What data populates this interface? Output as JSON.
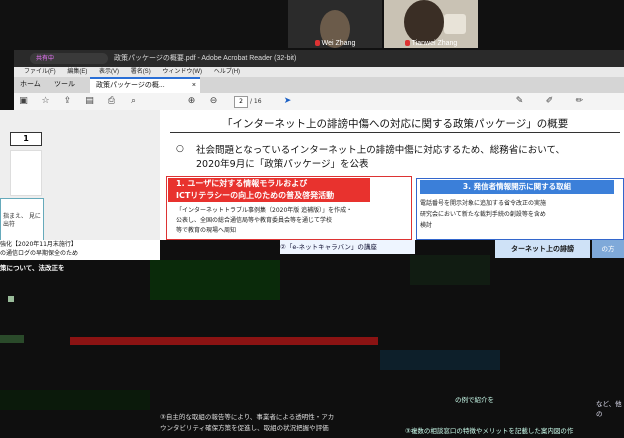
{
  "video": {
    "participants": [
      {
        "name": "Wei Zhang"
      },
      {
        "name": "Tianwei Zhang"
      }
    ]
  },
  "window": {
    "title": "政策パッケージの概要.pdf - Adobe Acrobat Reader (32-bit)",
    "share_indicator": "共有中"
  },
  "menu": {
    "items": [
      "ファイル(F)",
      "編集(E)",
      "表示(V)",
      "署名(S)",
      "ウィンドウ(W)",
      "ヘルプ(H)"
    ]
  },
  "tabs": [
    {
      "label": "ホーム"
    },
    {
      "label": "ツール"
    },
    {
      "label": "政策パッケージの概..."
    }
  ],
  "toolbar": {
    "page_current": "2",
    "page_total": "/ 16",
    "icons": [
      "save-icon",
      "star-icon",
      "upload-icon",
      "print-settings-icon",
      "print-icon",
      "search-icon",
      "page-up-icon",
      "page-down-icon",
      "pointer-icon"
    ]
  },
  "sidebar": {
    "page_number": "1",
    "fragment": "指まえ、 見に出符"
  },
  "document": {
    "title": "「インターネット上の誹謗中傷への対応に関する政策パッケージ」の概要",
    "bullet": "○",
    "intro_line1": "社会問題となっているインターネット上の誹謗中傷に対応するため、総務省において、",
    "intro_line2": "2020年9月に「政策パッケージ」を公表",
    "section1": {
      "heading_line1": "1. ユーザに対する情報モラルおよび",
      "heading_line2": "ICTリテラシーの向上のための普及啓発活動",
      "body_line1": "「インターネットトラブル事例集（2020年版 追補版）」を作成・",
      "body_line2": "公表し、全国の総合通信局等や教育委員会等を通じて学校",
      "body_line3": "等で教育の現場へ周知"
    },
    "section3": {
      "heading": "3. 発信者情報開示に関する取組",
      "body_line1": "電話番号を開示対象に追加する省令改正の実施",
      "body_line2": "研究会において新たな裁判手続の創設等を含め",
      "body_line3": "検討"
    }
  },
  "fragments": {
    "left_lines": [
      "強化【2020年11月末施行】",
      "の通信ログの早期保全のため"
    ],
    "left_line3": "策について、法改正を",
    "mid": "②「e-ネットキャラバン」の講座",
    "right": "ターネット上の誹謗",
    "right2": "の方",
    "bottom1_line1": "③自主的な取組の報告等により、事業者による透明性・アカ",
    "bottom1_line2": "ウンタビリティ確保方策を促進し、取組の状況把握や評価",
    "bottom2": "の例で紹介を",
    "bottom3": "③複数の相談窓口の特徴やメリットを記載した案内図の作",
    "bottom4": "など、他の"
  },
  "colors": {
    "section1_red": "#e8322e",
    "section3_blue": "#3b7fd9",
    "accent_blue": "#2a6fd6"
  }
}
